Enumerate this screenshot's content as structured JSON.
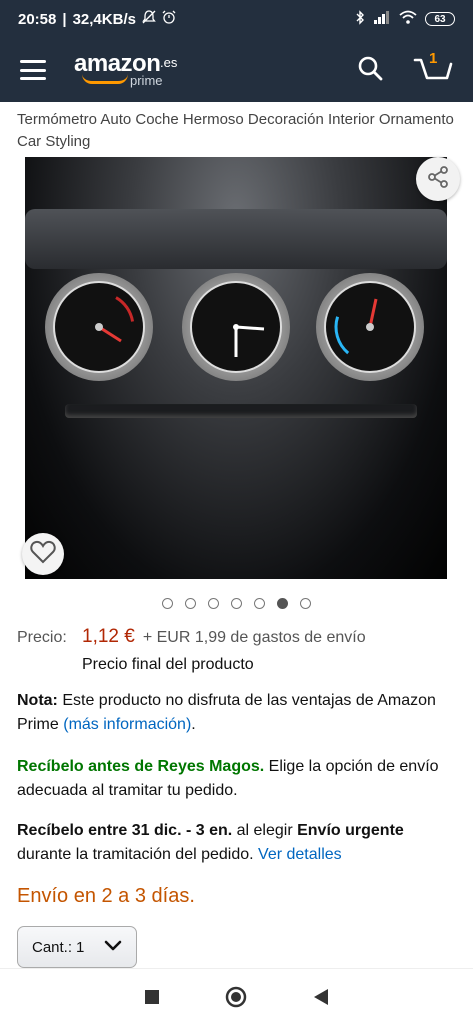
{
  "status_bar": {
    "time": "20:58",
    "network_speed": "32,4KB/s",
    "battery": "63"
  },
  "header": {
    "logo_text": "amazon",
    "logo_tld": ".es",
    "logo_sub": "prime",
    "cart_count": "1"
  },
  "product": {
    "title": "Termómetro Auto Coche Hermoso Decoración Interior Ornamento Car Styling",
    "image_index": 6,
    "image_count": 7
  },
  "pricing": {
    "label": "Precio:",
    "price": "1,12 €",
    "shipping": "+ EUR 1,99 de gastos de envío",
    "final_note": "Precio final del producto"
  },
  "note": {
    "label": "Nota:",
    "text": " Este producto no disfruta de las ventajas de Amazon Prime ",
    "link": "(más información)",
    "end": "."
  },
  "reyes": {
    "bold": "Recíbelo antes de Reyes Magos.",
    "text": " Elige la opción de envío adecuada al tramitar tu pedido."
  },
  "urgent": {
    "bold1": "Recíbelo entre 31 dic. - 3 en.",
    "text1": " al elegir ",
    "bold2": "Envío urgente",
    "text2": " durante la tramitación del pedido. ",
    "link": "Ver detalles"
  },
  "delivery": "Envío en 2 a 3 días.",
  "quantity": {
    "label": "Cant.:",
    "value": "1"
  },
  "colors": {
    "header_bg": "#232f3e",
    "price": "#b12704",
    "link": "#0066c0",
    "green": "#007600",
    "delivery": "#c45500",
    "accent": "#ff9900"
  },
  "icons": [
    "menu-icon",
    "search-icon",
    "cart-icon",
    "share-icon",
    "heart-icon",
    "chevron-down-icon",
    "nav-recents-icon",
    "nav-home-icon",
    "nav-back-icon"
  ]
}
